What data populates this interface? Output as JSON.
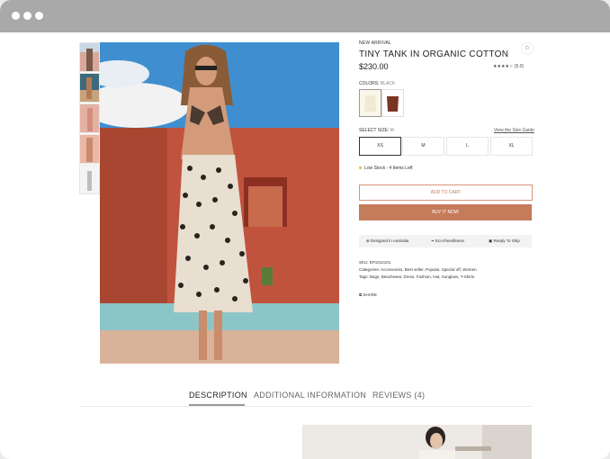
{
  "window": {
    "dots": [
      "dot",
      "dot",
      "dot"
    ]
  },
  "product": {
    "badge": "NEW ARRIVAL",
    "title": "TINY TANK IN ORGANIC COTTON",
    "price": "$230.00",
    "rating_stars": "★★★★☆",
    "rating_count": "(5.0)",
    "colors_label": "COLORS:",
    "color_value": "BLACK",
    "size_label": "SELECT SIZE:",
    "size_value": "M",
    "size_guide": "View the Size Guide",
    "sizes": [
      "XS",
      "M",
      "L",
      "XL"
    ],
    "selected_size": "XS",
    "stock": "Low Stock - 4 Items Left",
    "add_to_cart": "ADD TO CART",
    "buy_now": "BUY IT NOW",
    "features": [
      "Designed in Australia",
      "Eco-friendliness",
      "Ready To Ship"
    ],
    "sku": "SKU: EP1012101",
    "categories": "Categories: Accessories, Best seller, Popular, Special off, Women",
    "tags": "Tags: Bags, Beachwear, Dress, Fashion, Hat, Sunglass, T-Shirts",
    "share": "SHARE"
  },
  "tabs": [
    "DESCRIPTION",
    "ADDITIONAL INFORMATION",
    "REVIEWS (4)"
  ],
  "colors": {
    "accent": "#c57c5b",
    "stock_dot": "#e8b84a",
    "titlebar": "#a9a9a9"
  }
}
